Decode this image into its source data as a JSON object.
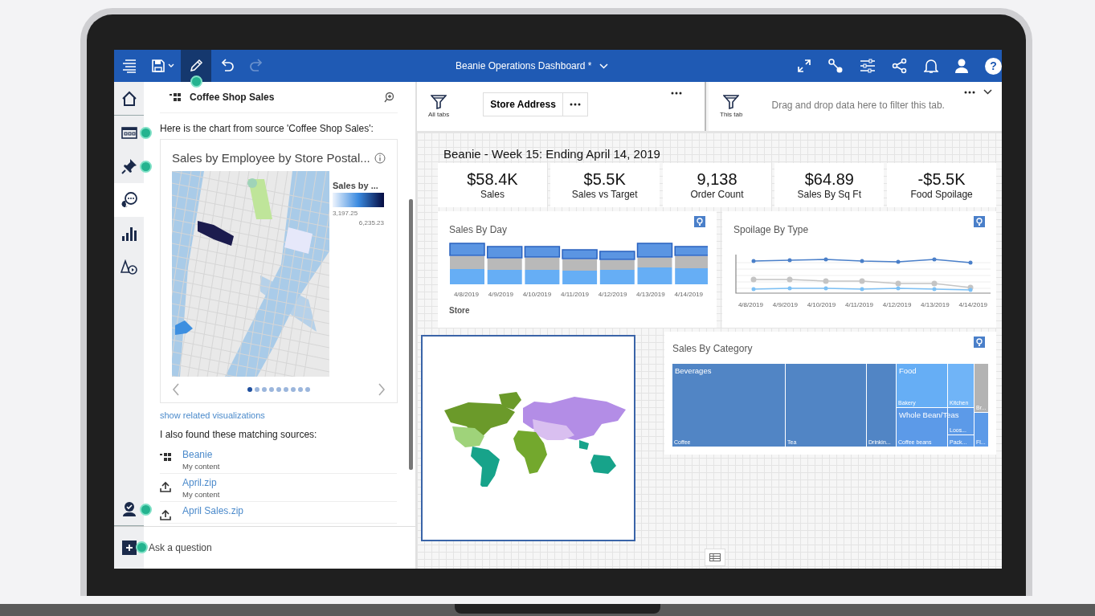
{
  "toolbar": {
    "title": "Beanie Operations Dashboard *",
    "help_glyph": "?",
    "left_tools": [
      {
        "kind": "menu",
        "selected": false,
        "disabled": false,
        "hotspot": false
      },
      {
        "kind": "save",
        "selected": false,
        "disabled": false,
        "hotspot": false
      },
      {
        "kind": "edit",
        "selected": true,
        "disabled": false,
        "hotspot": true
      },
      {
        "kind": "undo",
        "selected": false,
        "disabled": false,
        "hotspot": false
      },
      {
        "kind": "redo",
        "selected": false,
        "disabled": true,
        "hotspot": false
      }
    ],
    "right_tools": [
      {
        "kind": "expand"
      },
      {
        "kind": "connect"
      },
      {
        "kind": "sliders"
      },
      {
        "kind": "share"
      },
      {
        "kind": "bell"
      },
      {
        "kind": "user"
      }
    ]
  },
  "rail": {
    "top": [
      {
        "kind": "home",
        "selected": false,
        "hotspot": false
      },
      {
        "kind": "data",
        "selected": false,
        "hotspot": true
      },
      {
        "kind": "pin",
        "selected": false,
        "hotspot": true
      },
      {
        "kind": "assistant",
        "selected": true,
        "hotspot": false
      },
      {
        "kind": "chart",
        "selected": false,
        "hotspot": false
      },
      {
        "kind": "shapes",
        "selected": false,
        "hotspot": false
      }
    ],
    "bottom": [
      {
        "kind": "badge",
        "selected": false,
        "hotspot": true
      }
    ]
  },
  "panel": {
    "header": "Coffee Shop Sales",
    "intro": "Here is the chart from source 'Coffee Shop Sales':",
    "card": {
      "title": "Sales by Employee by Store Postal...",
      "legend_title": "Sales by ...",
      "legend_min": "3,197.25",
      "legend_max": "6,235.23",
      "pages": [
        {
          "selected": true
        },
        {
          "selected": false
        },
        {
          "selected": false
        },
        {
          "selected": false
        },
        {
          "selected": false
        },
        {
          "selected": false
        },
        {
          "selected": false
        },
        {
          "selected": false
        },
        {
          "selected": false
        }
      ]
    },
    "link": "show related visualizations",
    "matches_intro": "I also found these matching sources:",
    "sources": [
      {
        "kind": "dataset",
        "name": "Beanie",
        "location": "My content"
      },
      {
        "kind": "upload",
        "name": "April.zip",
        "location": "My content"
      },
      {
        "kind": "upload",
        "name": "April Sales.zip"
      }
    ],
    "question": {
      "placeholder": "Ask a question",
      "hotspot": true
    }
  },
  "filters": {
    "all_tabs": "All tabs",
    "chip": "Store Address",
    "this_tab": "This tab",
    "drop_hint": "Drag and drop data here to filter this tab."
  },
  "dashboard": {
    "title": "Beanie - Week 15: Ending April 14, 2019",
    "kpis": [
      {
        "value": "$58.4K",
        "label": "Sales"
      },
      {
        "value": "$5.5K",
        "label": "Sales vs Target"
      },
      {
        "value": "9,138",
        "label": "Order Count"
      },
      {
        "value": "$64.89",
        "label": "Sales By Sq Ft"
      },
      {
        "value": "-$5.5K",
        "label": "Food Spoilage"
      }
    ],
    "sales_by_day": {
      "title": "Sales By Day",
      "x_labels": [
        "4/8/2019",
        "4/9/2019",
        "4/10/2019",
        "4/11/2019",
        "4/12/2019",
        "4/13/2019",
        "4/14/2019"
      ],
      "legend": "Store"
    },
    "spoilage": {
      "title": "Spoilage By Type",
      "x_labels": [
        "4/8/2019",
        "4/9/2019",
        "4/10/2019",
        "4/11/2019",
        "4/12/2019",
        "4/13/2019",
        "4/14/2019"
      ]
    },
    "world_map": {
      "selected": true
    },
    "category": {
      "title": "Sales By Category",
      "tiles": [
        {
          "label": "Beverages",
          "sublabel": "Coffee"
        },
        {
          "sublabel": "Tea"
        },
        {
          "sublabel": "Drinkin..."
        },
        {
          "label": "Food",
          "sublabel": "Bakery"
        },
        {
          "sublabel": "Kitchen"
        },
        {
          "sublabel": "Br..."
        },
        {
          "label": "Whole Bean/Teas",
          "sublabel": "Coffee beans"
        },
        {
          "sublabel": "Loos..."
        },
        {
          "sublabel": "Pack..."
        },
        {
          "sublabel": "Fl..."
        }
      ]
    }
  }
}
